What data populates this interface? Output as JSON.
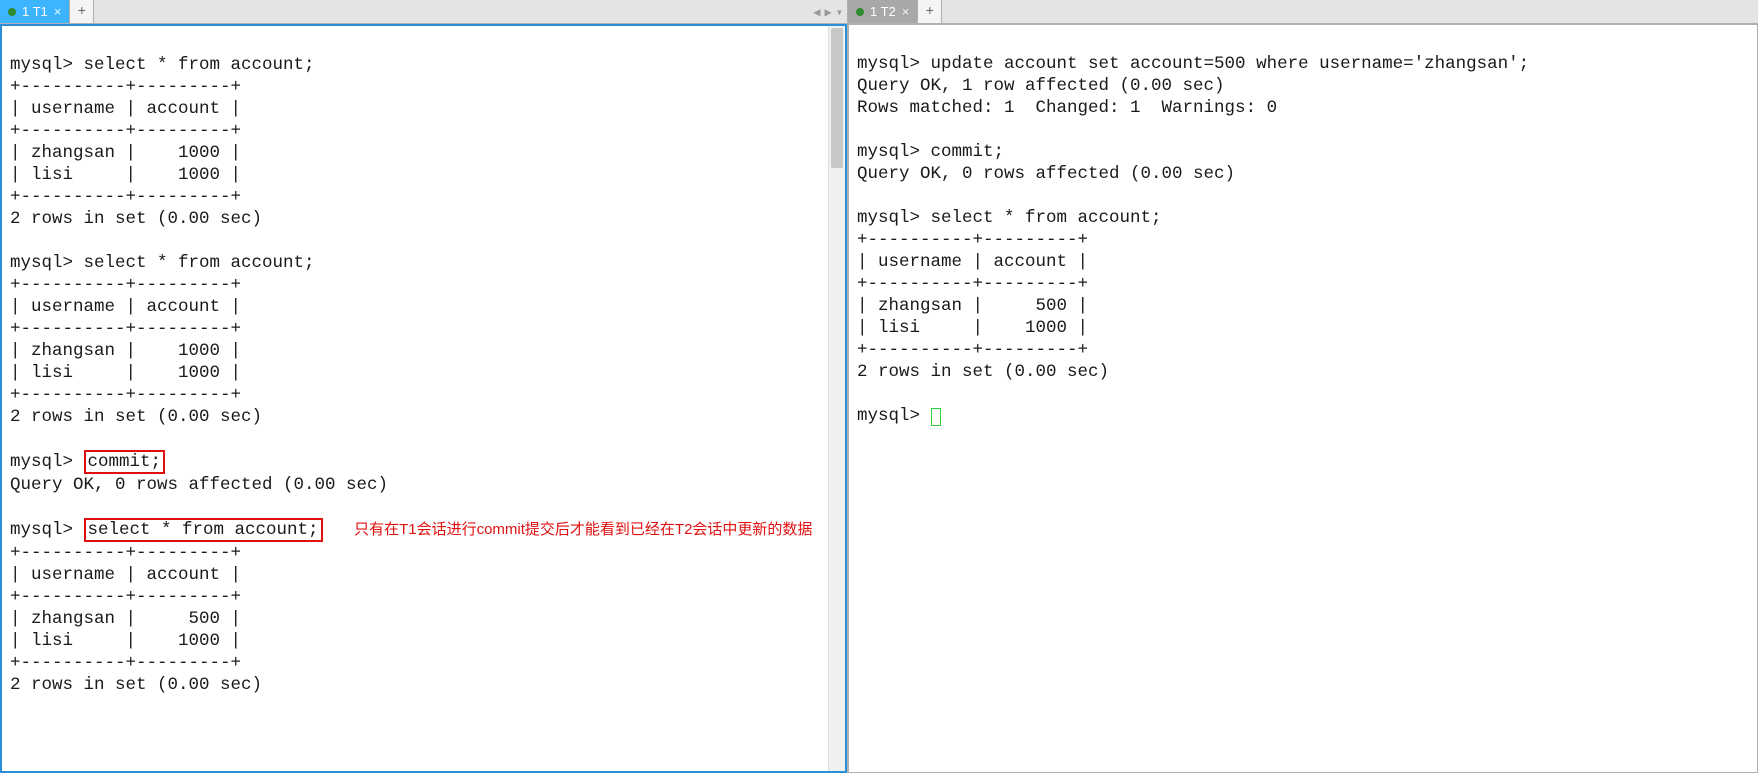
{
  "left": {
    "tab": {
      "label": "1 T1",
      "close": "×"
    },
    "addtab": "+",
    "nav": {
      "prev": "◀",
      "next": "▶",
      "menu": "▾"
    },
    "lines": {
      "p1": "mysql> select * from account;",
      "sep": "+----------+---------+",
      "hdr": "| username | account |",
      "r1a": "| zhangsan |    1000 |",
      "r1b": "| lisi     |    1000 |",
      "rs": "2 rows in set (0.00 sec)",
      "p2": "mysql> select * from account;",
      "p3p": "mysql> ",
      "p3c": "commit;",
      "qok": "Query OK, 0 rows affected (0.00 sec)",
      "p4p": "mysql> ",
      "p4c": "select * from account;",
      "r3a": "| zhangsan |     500 |",
      "r3b": "| lisi     |    1000 |"
    },
    "annotation": "只有在T1会话进行commit提交后才能看到已经在T2会话中更新的数据"
  },
  "right": {
    "tab": {
      "label": "1 T2",
      "close": "×"
    },
    "addtab": "+",
    "lines": {
      "p1": "mysql> update account set account=500 where username='zhangsan';",
      "q1": "Query OK, 1 row affected (0.00 sec)",
      "q2": "Rows matched: 1  Changed: 1  Warnings: 0",
      "p2": "mysql> commit;",
      "q3": "Query OK, 0 rows affected (0.00 sec)",
      "p3": "mysql> select * from account;",
      "sep": "+----------+---------+",
      "hdr": "| username | account |",
      "r1": "| zhangsan |     500 |",
      "r2": "| lisi     |    1000 |",
      "rs": "2 rows in set (0.00 sec)",
      "p4": "mysql> "
    }
  }
}
